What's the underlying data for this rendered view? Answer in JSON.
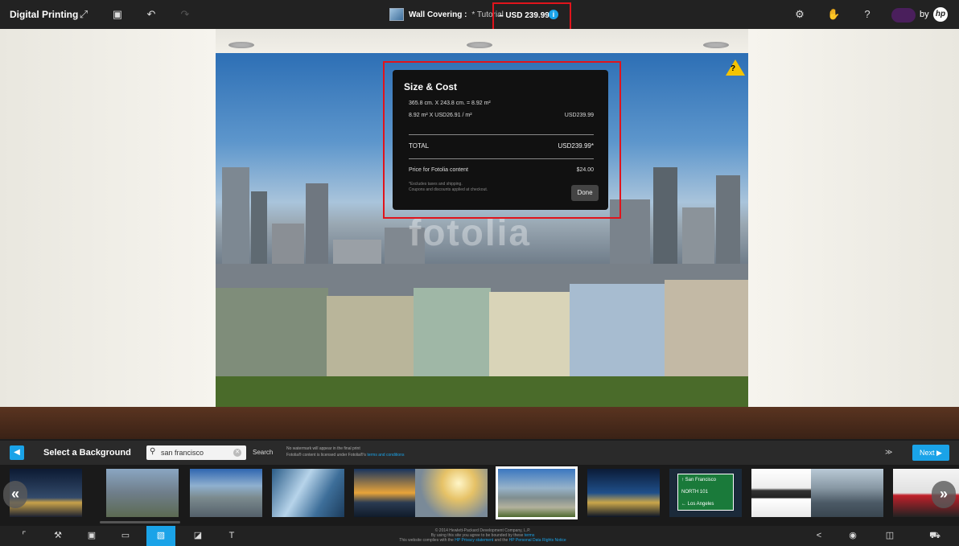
{
  "topbar": {
    "brand": "Digital Printing",
    "title_main": "Wall Covering :",
    "title_sub": "* Tutorial",
    "price": "– USD 239.99",
    "info_icon": "i",
    "by": "by",
    "logo_text": "hp",
    "settings_icon": "⚙",
    "help_icon": "?"
  },
  "popup": {
    "title": "Size & Cost",
    "dimensions": "365.8 cm. X 243.8 cm. = 8.92 m²",
    "rate_label": "8.92 m² X USD26.91 / m²",
    "rate_total": "USD239.99",
    "total_label": "TOTAL",
    "total_value": "USD239.99*",
    "fotolia_label": "Price for Fotolia content",
    "fotolia_value": "$24.00",
    "fine_line1": "*Excludes taxes and shipping.",
    "fine_line2": "Coupons and discounts applied at checkout.",
    "done_label": "Done"
  },
  "wallpaper": {
    "watermark": "fotolia",
    "warning_mark": "?"
  },
  "panel": {
    "title": "Select a Background",
    "search_value": "san francisco",
    "search_button": "Search",
    "notice_line1": "No watermark will appear in the final print",
    "notice_line2": "Fotolia® content is licensed under Fotolia®'s ",
    "notice_link": "terms and conditions",
    "next_label": "Next ▶",
    "collapse_icon": "»"
  },
  "thumbnails": [
    {
      "name": "Bay Bridge night"
    },
    {
      "name": "Coit Tower city"
    },
    {
      "name": "City aerial"
    },
    {
      "name": "Skyscrapers glass"
    },
    {
      "name": "Sunset skyline"
    },
    {
      "name": "Bridge sunlight"
    },
    {
      "name": "Painted Ladies"
    },
    {
      "name": "Bay Bridge lights"
    },
    {
      "name": "Highway sign"
    },
    {
      "name": "Skyline silhouette"
    },
    {
      "name": "Marina boats"
    },
    {
      "name": "Golden Gate silhouette"
    }
  ],
  "sign_text": [
    "↑ San Francisco",
    "NORTH 101",
    "← Los Angeles"
  ],
  "footer": {
    "line1": "© 2014 Hewlett-Packard Development Company, L.P.",
    "line2": "By using this site you agree to be bounded by these ",
    "line2_link": "terms",
    "line3": "This website complies with the ",
    "line3_link1": "HP Privacy statement",
    "line3_mid": " and the ",
    "line3_link2": "HP Personal Data Rights Notice"
  }
}
